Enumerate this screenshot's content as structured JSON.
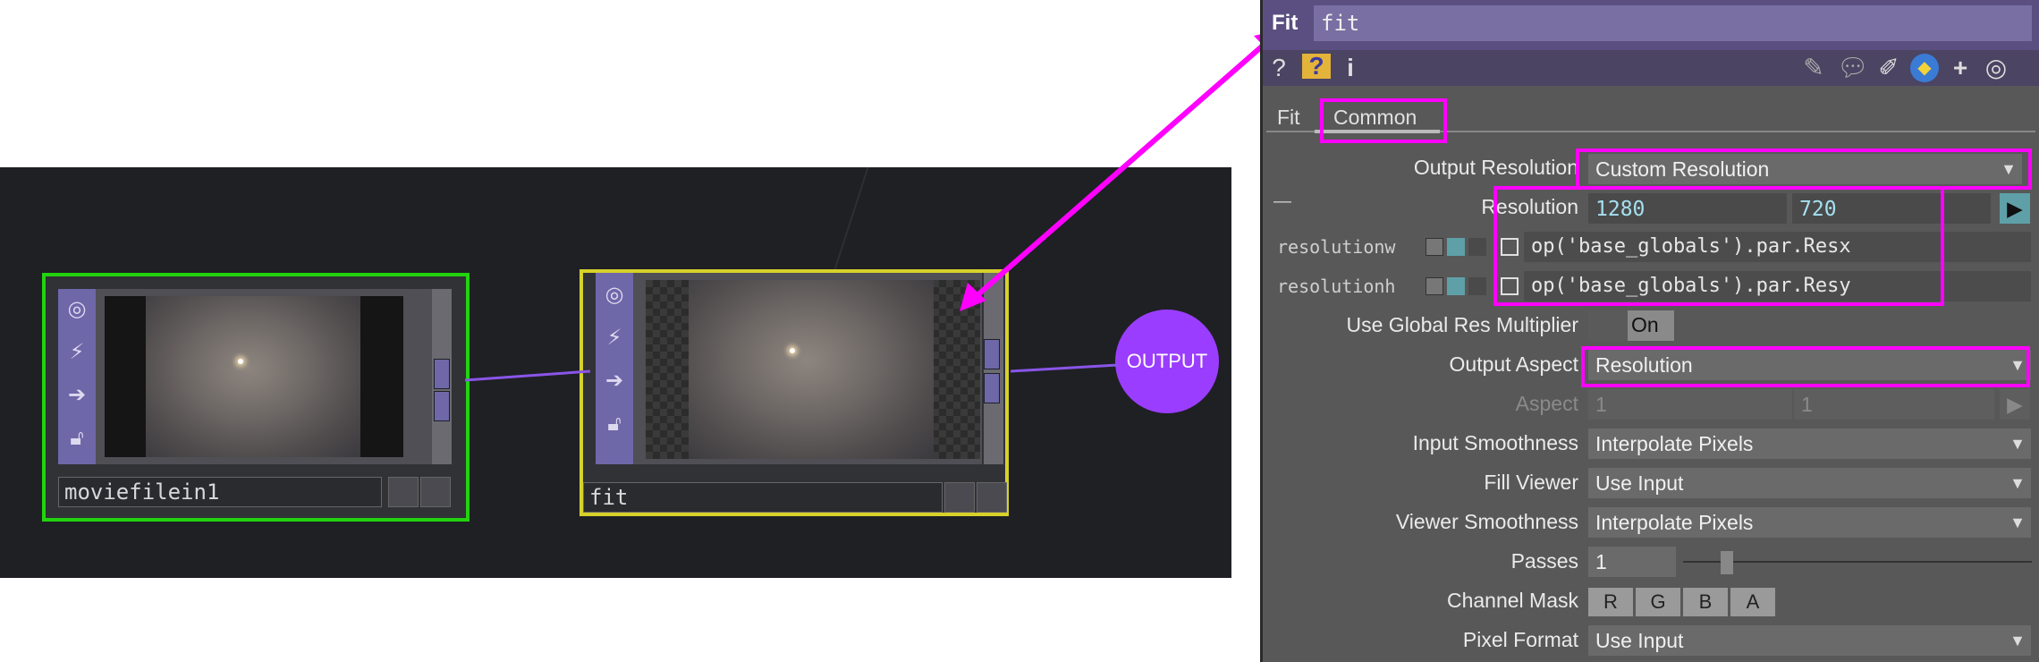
{
  "network": {
    "nodes": [
      {
        "name": "moviefilein1"
      },
      {
        "name": "fit"
      }
    ],
    "output_label": "OUTPUT"
  },
  "panel": {
    "op_type": "Fit",
    "op_name": "fit",
    "toolbar_left": [
      "?",
      "?",
      "i"
    ],
    "tabs": [
      "Fit",
      "Common"
    ],
    "params": {
      "output_resolution": {
        "label": "Output Resolution",
        "value": "Custom Resolution"
      },
      "resolution": {
        "label": "Resolution",
        "x": "1280",
        "y": "720",
        "prefix": "—"
      },
      "resolutionw": {
        "label": "resolutionw",
        "expr": "op('base_globals').par.Resx"
      },
      "resolutionh": {
        "label": "resolutionh",
        "expr": "op('base_globals').par.Resy"
      },
      "global_res_mult": {
        "label": "Use Global Res Multiplier",
        "value": "On"
      },
      "output_aspect": {
        "label": "Output Aspect",
        "value": "Resolution"
      },
      "aspect": {
        "label": "Aspect",
        "x": "1",
        "y": "1"
      },
      "input_smoothness": {
        "label": "Input Smoothness",
        "value": "Interpolate Pixels"
      },
      "fill_viewer": {
        "label": "Fill Viewer",
        "value": "Use Input"
      },
      "viewer_smoothness": {
        "label": "Viewer Smoothness",
        "value": "Interpolate Pixels"
      },
      "passes": {
        "label": "Passes",
        "value": "1"
      },
      "channel_mask": {
        "label": "Channel Mask",
        "channels": [
          "R",
          "G",
          "B",
          "A"
        ]
      },
      "pixel_format": {
        "label": "Pixel Format",
        "value": "Use Input"
      }
    }
  },
  "colors": {
    "highlight": "#ff00ff",
    "selected_node_green": "#22d30e",
    "current_node_yellow": "#d7d12a",
    "output_node": "#9b3dff",
    "wire": "#8a55e8"
  }
}
